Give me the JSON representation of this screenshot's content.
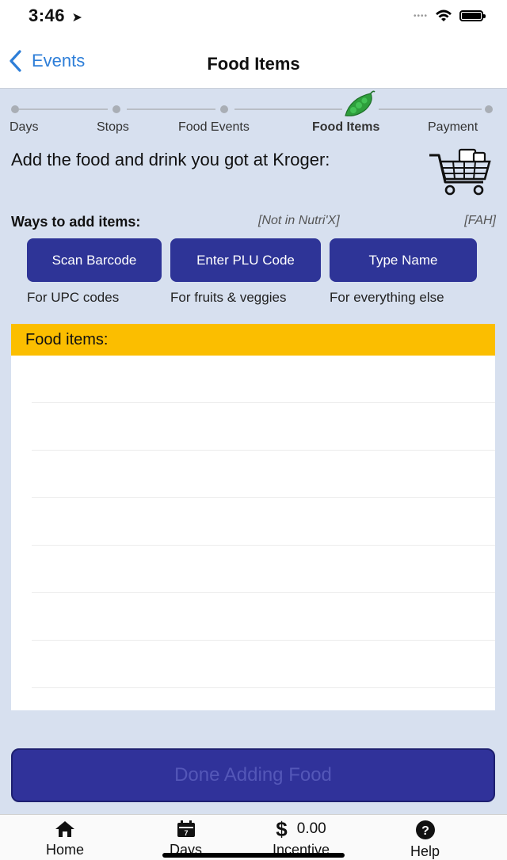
{
  "status_bar": {
    "time": "3:46"
  },
  "nav": {
    "back_label": "Events",
    "title": "Food Items"
  },
  "stepper": {
    "steps": [
      {
        "label": "Days"
      },
      {
        "label": "Stops"
      },
      {
        "label": "Food Events"
      },
      {
        "label": "Food Items",
        "active": true
      },
      {
        "label": "Payment"
      }
    ]
  },
  "intro": {
    "text": "Add the food and drink you got at Kroger:"
  },
  "ways": {
    "label": "Ways to add items:",
    "not_in_label": "[Not in Nutri'X]",
    "fah_label": "[FAH]",
    "buttons": [
      {
        "label": "Scan Barcode",
        "caption": "For UPC codes"
      },
      {
        "label": "Enter PLU Code",
        "caption": "For fruits & veggies"
      },
      {
        "label": "Type Name",
        "caption": "For everything else"
      }
    ]
  },
  "food_list": {
    "header": "Food items:"
  },
  "done_button": {
    "label": "Done Adding Food"
  },
  "tab_bar": {
    "items": [
      {
        "label": "Home",
        "icon": "home-icon"
      },
      {
        "label": "Days",
        "icon": "calendar-icon"
      },
      {
        "label": "Incentive",
        "icon": "dollar-icon",
        "value": "0.00"
      },
      {
        "label": "Help",
        "icon": "help-icon"
      }
    ]
  },
  "colors": {
    "accent_blue": "#2d7ed8",
    "button_navy": "#2e3497",
    "header_yellow": "#fbbe00",
    "background": "#d7e0ef",
    "peas_green": "#2e9e3c"
  }
}
